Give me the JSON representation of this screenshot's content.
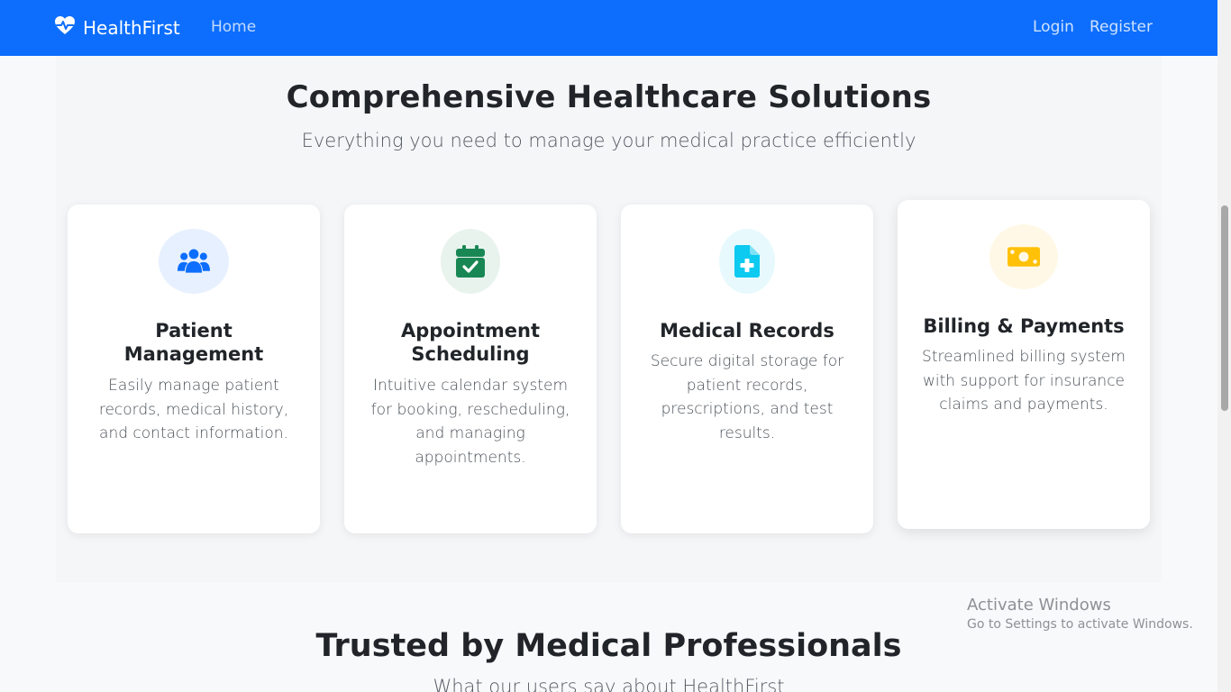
{
  "navbar": {
    "brand": "HealthFirst",
    "brand_icon": "heart-pulse-icon",
    "home": "Home",
    "login": "Login",
    "register": "Register",
    "color": "#0d6efd"
  },
  "features": {
    "title": "Comprehensive Healthcare Solutions",
    "subtitle": "Everything you need to manage your medical practice efficiently",
    "cards": [
      {
        "icon": "users-icon",
        "icon_color": "#0d6efd",
        "icon_bg": "#e7f0fe",
        "title": "Patient Management",
        "description": "Easily manage patient records, medical history, and contact information."
      },
      {
        "icon": "calendar-check-icon",
        "icon_color": "#198754",
        "icon_bg": "#e8f3ee",
        "title": "Appointment Scheduling",
        "description": "Intuitive calendar system for booking, rescheduling, and managing appointments."
      },
      {
        "icon": "file-medical-icon",
        "icon_color": "#0dcaf0",
        "icon_bg": "#e7f9fd",
        "title": "Medical Records",
        "description": "Secure digital storage for patient records, prescriptions, and test results."
      },
      {
        "icon": "money-bill-icon",
        "icon_color": "#ffc107",
        "icon_bg": "#fff8e6",
        "title": "Billing & Payments",
        "description": "Streamlined billing system with support for insurance claims and payments."
      }
    ]
  },
  "testimonials": {
    "title": "Trusted by Medical Professionals",
    "subtitle": "What our users say about HealthFirst"
  },
  "watermark": {
    "title": "Activate Windows",
    "subtitle": "Go to Settings to activate Windows."
  }
}
